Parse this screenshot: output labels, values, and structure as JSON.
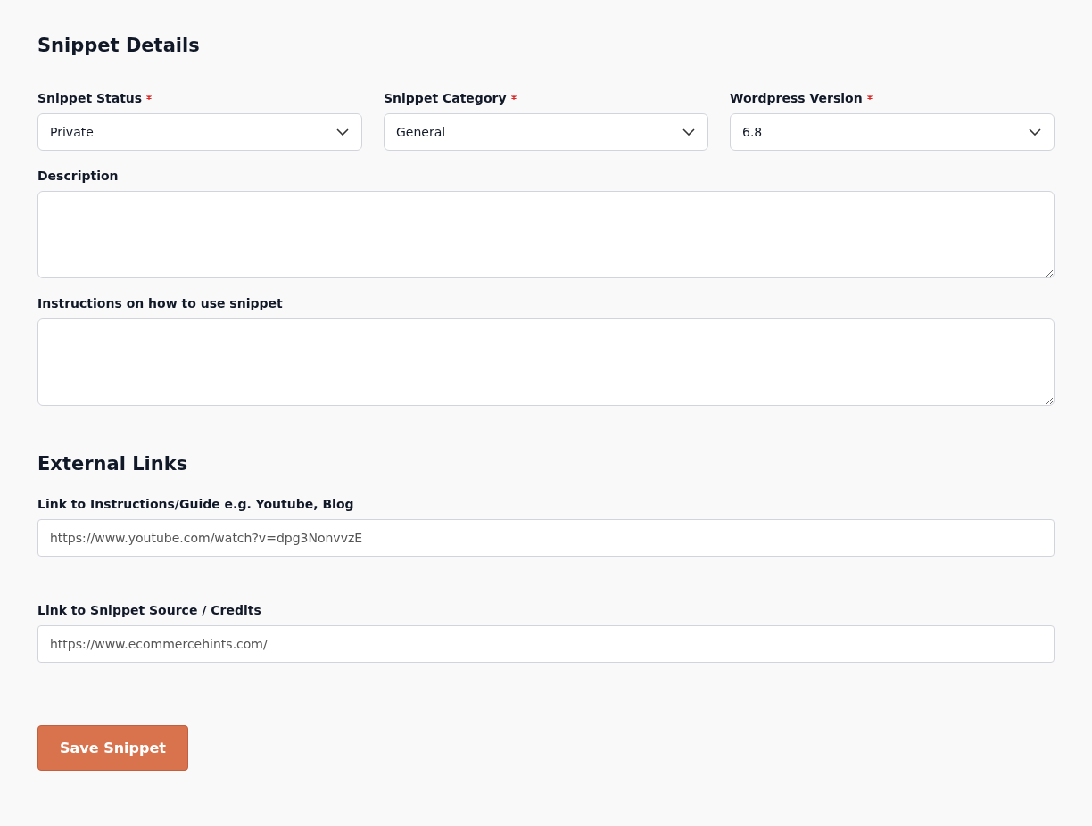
{
  "sections": [
    {
      "title": "Snippet Details",
      "rows": [
        {
          "fields": [
            {
              "kind": "select",
              "label": "Snippet Status",
              "required": true,
              "value": "Private"
            },
            {
              "kind": "select",
              "label": "Snippet Category",
              "required": true,
              "value": "General"
            },
            {
              "kind": "select",
              "label": "Wordpress Version",
              "required": true,
              "value": "6.8"
            }
          ]
        },
        {
          "fields": [
            {
              "kind": "textarea",
              "label": "Description",
              "required": false
            }
          ]
        },
        {
          "fields": [
            {
              "kind": "textarea",
              "label": "Instructions on how to use snippet",
              "required": false
            }
          ]
        }
      ]
    },
    {
      "title": "External Links",
      "rows": [
        {
          "fields": [
            {
              "kind": "text",
              "label": "Link to Instructions/Guide e.g. Youtube, Blog",
              "required": false,
              "placeholder": "https://www.youtube.com/watch?v=dpg3NonvvzE"
            }
          ]
        },
        {
          "fields": [
            {
              "kind": "text",
              "label": "Link to Snippet Source / Credits",
              "required": false,
              "placeholder": "https://www.ecommercehints.com/"
            }
          ]
        }
      ]
    }
  ],
  "save_button": "Save Snippet"
}
